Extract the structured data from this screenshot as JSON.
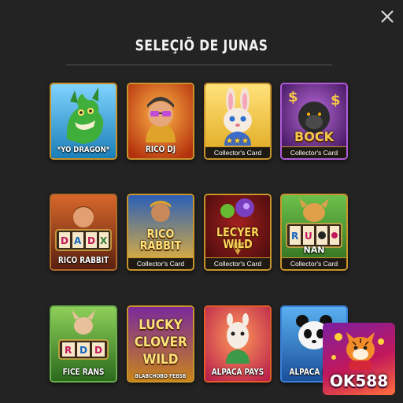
{
  "modal": {
    "title": "SELEÇIÕ DE JUNAS",
    "close_icon": "close-icon"
  },
  "cards": [
    {
      "name": "*YO DRAGON*",
      "banner": "",
      "stars": ""
    },
    {
      "name": "RICO DJ",
      "banner": "",
      "stars": ""
    },
    {
      "name": "",
      "banner": "Collector's Card",
      "stars": "★★★"
    },
    {
      "name": "BOCK",
      "banner": "Collector's Card",
      "stars": ""
    },
    {
      "name": "RICO RABBIT",
      "banner": "",
      "stars": ""
    },
    {
      "name": "RICO RABBIT",
      "banner": "Collector's Card",
      "stars": ""
    },
    {
      "name": "LECYER WILD",
      "banner": "Collector's Card",
      "stars": ""
    },
    {
      "name": "NAN",
      "banner": "Collector's Card",
      "stars": ""
    },
    {
      "name": "FICE RANS",
      "banner": "",
      "stars": ""
    },
    {
      "name": "LUCKY CLOVER WILD",
      "sub": "BLABCHOBD FEBSB",
      "banner": "",
      "stars": ""
    },
    {
      "name": "ALPACA PAYS",
      "banner": "",
      "stars": ""
    },
    {
      "name": "ALPACA P",
      "banner": "",
      "stars": ""
    }
  ],
  "overlay_logo": {
    "text": "OK588"
  },
  "colors": {
    "background": "#232323",
    "card_border": "#c9942b",
    "banner_bg": "#1e1a12"
  }
}
